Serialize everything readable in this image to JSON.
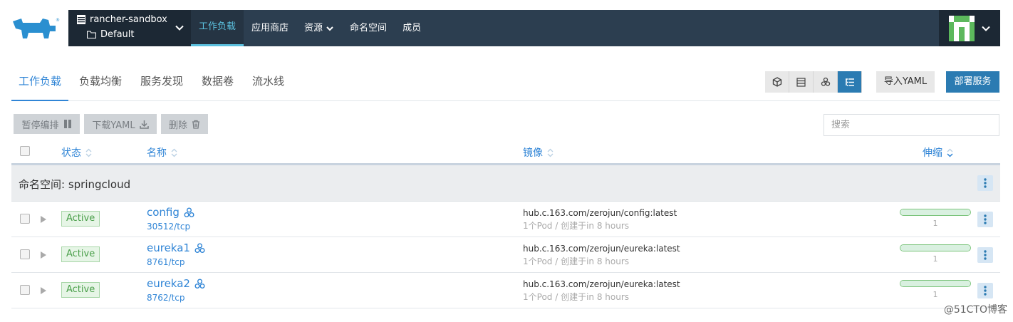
{
  "header": {
    "cluster_name": "rancher-sandbox",
    "project_name": "Default",
    "nav": [
      {
        "label": "工作负载"
      },
      {
        "label": "应用商店"
      },
      {
        "label": "资源"
      },
      {
        "label": "命名空间"
      },
      {
        "label": "成员"
      }
    ]
  },
  "subtabs": [
    {
      "label": "工作负载"
    },
    {
      "label": "负载均衡"
    },
    {
      "label": "服务发现"
    },
    {
      "label": "数据卷"
    },
    {
      "label": "流水线"
    }
  ],
  "toolbar": {
    "import_yaml": "导入YAML",
    "deploy": "部署服务"
  },
  "bulk_actions": {
    "pause": "暂停编排",
    "download_yaml": "下载YAML",
    "delete": "删除"
  },
  "search": {
    "placeholder": "搜索"
  },
  "table": {
    "columns": {
      "state": "状态",
      "name": "名称",
      "image": "镜像",
      "scale": "伸缩"
    },
    "group_label": "命名空间: springcloud",
    "rows": [
      {
        "state": "Active",
        "name": "config",
        "port": "30512/tcp",
        "image": "hub.c.163.com/zerojun/config:latest",
        "meta": "1个Pod / 创建于in 8 hours",
        "scale": "1",
        "scale_fraction": 1.0
      },
      {
        "state": "Active",
        "name": "eureka1",
        "port": "8761/tcp",
        "image": "hub.c.163.com/zerojun/eureka:latest",
        "meta": "1个Pod / 创建于in 8 hours",
        "scale": "1",
        "scale_fraction": 1.0
      },
      {
        "state": "Active",
        "name": "eureka2",
        "port": "8762/tcp",
        "image": "hub.c.163.com/zerojun/eureka:latest",
        "meta": "1个Pod / 创建于in 8 hours",
        "scale": "1",
        "scale_fraction": 1.0
      }
    ]
  },
  "watermark": "@51CTO博客",
  "colors": {
    "nav_bg": "#2c3e50",
    "accent": "#3085d6",
    "primary_button": "#2b7bb2",
    "active_state": "#4a9f4a"
  }
}
